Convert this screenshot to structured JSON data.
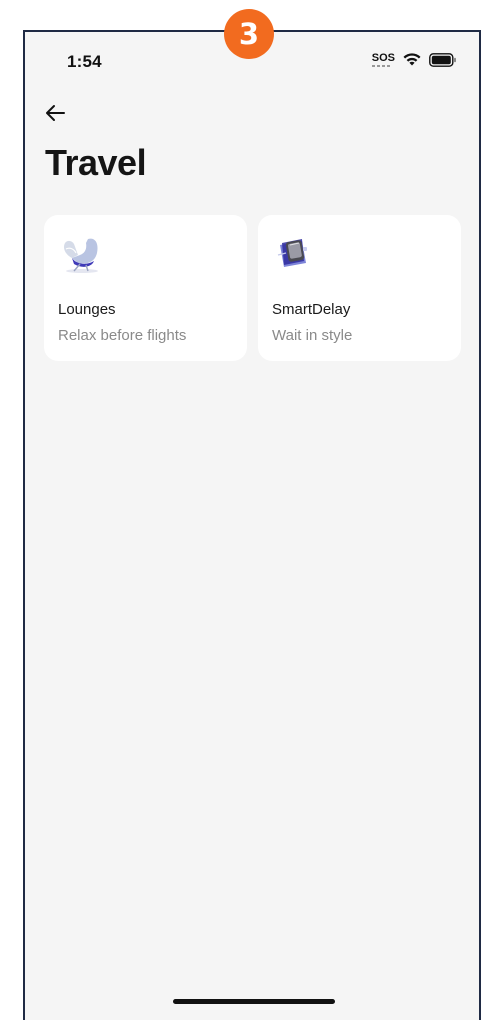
{
  "step_badge": "3",
  "status_bar": {
    "time": "1:54",
    "sos_label": "SOS",
    "icons": [
      "sos-icon",
      "wifi-icon",
      "battery-icon"
    ]
  },
  "header": {
    "back_icon": "back-arrow-icon",
    "title": "Travel"
  },
  "cards": [
    {
      "icon": "lounge-chair-icon",
      "title": "Lounges",
      "subtitle": "Relax before flights"
    },
    {
      "icon": "smartdelay-device-icon",
      "title": "SmartDelay",
      "subtitle": "Wait in style"
    }
  ],
  "colors": {
    "badge": "#f26b1f",
    "background": "#f5f5f5",
    "card": "#ffffff",
    "frame": "#1f2a44",
    "subtitle": "#8a8a8a"
  }
}
